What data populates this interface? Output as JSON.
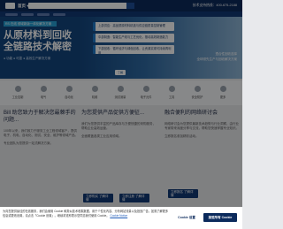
{
  "header": {
    "logo_text": "",
    "lang": "首页 ▾",
    "phone": "技术支持热线：400-675-2188"
  },
  "hero": {
    "tag": "RS 在线 领域新版一体化解决方案",
    "title_line1": "从原材料到回收",
    "title_line2": "全链路技术解密",
    "subtitle": "● 功能 ● 可靠 ● 高效生产解决方案",
    "cards": [
      "上游供应：高品质原材料精选与供应链质量控制管理",
      "中游制造：智能生产线与工艺优化，推动高效制造能力",
      "下游回收：循环经济与绿色回收，让资源实现可持续再利用"
    ],
    "right_line1": "遵合性回收选择",
    "right_line2": "全球领先生产与回收解决方案",
    "btn": "了解"
  },
  "categories": [
    "工业控制",
    "电气",
    "自动化",
    "机械",
    "测试测量",
    "电子元件",
    "工具",
    "安全防护",
    "更多"
  ],
  "columns": [
    {
      "title": "Bill 助您致力于解决您最棘手的问题...",
      "paras": [
        "100年以来，我们致力于服务工业工程领域客户，提供电子、机电、自动化、测试、安全、维护等领域产品。",
        "专业团队为您提供一站式解决方案。"
      ],
      "btn": "立即购买 了解详情"
    },
    {
      "title": "为您提供产品促供方便征...",
      "paras": [
        "我们为您提供丰富的产品库存与方便快捷的采购服务，帮助企业高效运营。",
        "全面覆盖各类工业应用领域。"
      ],
      "btn": "立即注册 了解详情"
    },
    {
      "title": "融合便利的网络研讨会",
      "paras": [
        "网络研讨会为您提供最新技术趋势与行业洞察，由行业专家带来深度分享与交流，帮助您快速掌握专业知识。",
        "立即报名参加精彩活动。"
      ],
      "btn": "立即报名 了解详情"
    }
  ],
  "cookie": {
    "text": "为向您提供最佳的在线服务，我们会使用 Cookie 和类似技术收集数据，用于个性化内容、分析网站流量以及投放广告。如需了解更多信息或更改设置，请点击「Cookie 设置」。继续浏览即表示您同意我们使用 Cookie。",
    "link": "Cookie Notice",
    "settings_label": "Cookie 设置",
    "accept_label": "接受所有 Cookie"
  }
}
